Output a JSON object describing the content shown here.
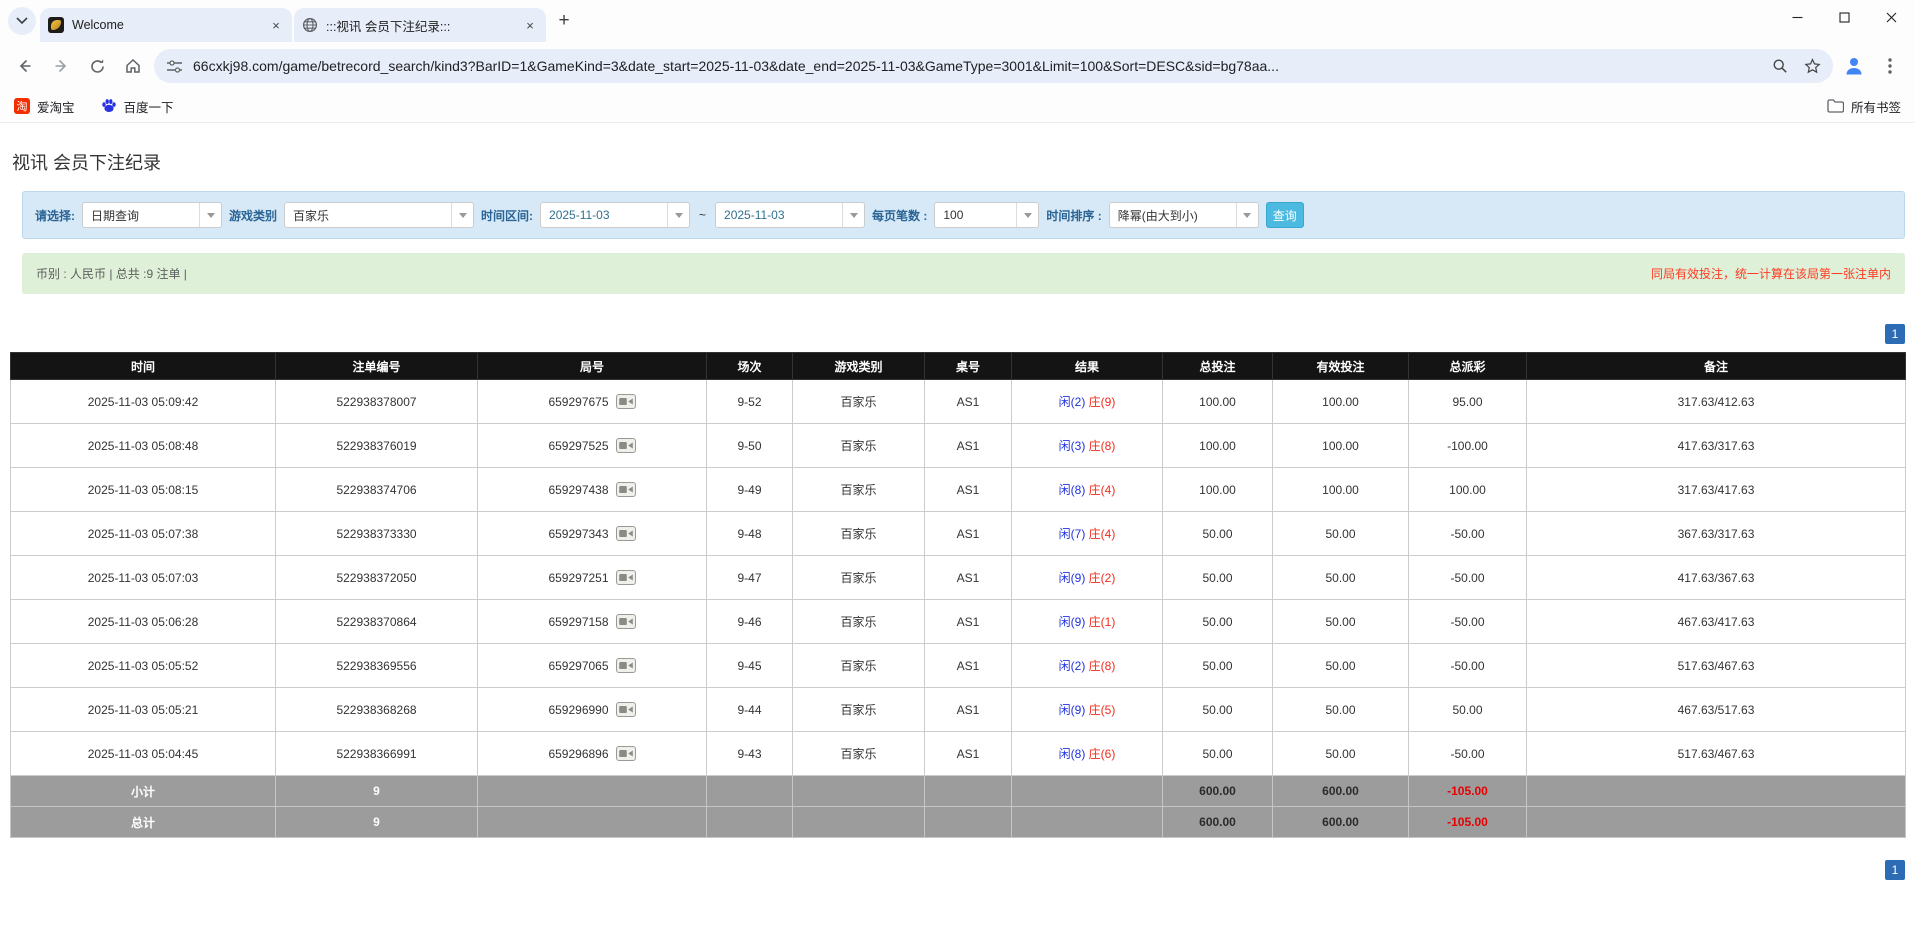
{
  "colors": {
    "filter_bg": "#d7e9f6",
    "info_bg": "#dff0d8",
    "header_bg": "#141414",
    "footer_bg": "#9c9c9c",
    "link_blue": "#0a64d2",
    "player_blue": "#1f32e0",
    "banker_red": "#f22b1d",
    "negative_red": "#f00000",
    "pagination_blue": "#2d6cb4",
    "button_blue": "#4cb9e0"
  },
  "browser": {
    "tabs": [
      {
        "title": "Welcome"
      },
      {
        "title": ":::视讯 会员下注纪录:::"
      }
    ],
    "close_glyph": "×",
    "newtab_glyph": "+",
    "url": "66cxkj98.com/game/betrecord_search/kind3?BarID=1&GameKind=3&date_start=2025-11-03&date_end=2025-11-03&GameType=3001&Limit=100&Sort=DESC&sid=bg78aa...",
    "bookmarks": [
      {
        "label": "爱淘宝",
        "icon_glyph": "淘"
      },
      {
        "label": "百度一下"
      }
    ],
    "bookmarks_right": "所有书签"
  },
  "page": {
    "title": "视讯 会员下注纪录",
    "filters": {
      "select_label": "请选择:",
      "select_value": "日期查询",
      "game_label": "游戏类别",
      "game_value": "百家乐",
      "range_label": "时间区间:",
      "date_start": "2025-11-03",
      "range_sep": "~",
      "date_end": "2025-11-03",
      "perpage_label": "每页笔数 :",
      "perpage_value": "100",
      "sort_label": "时间排序 :",
      "sort_value": "降幂(由大到小)",
      "search_button": "查询"
    },
    "infobar": {
      "left": "币别 : 人民币 | 总共 :9 注单 |",
      "right": "同局有效投注，统一计算在该局第一张注单内"
    },
    "pagination": "1",
    "table": {
      "headers": [
        "时间",
        "注单编号",
        "局号",
        "场次",
        "游戏类别",
        "桌号",
        "结果",
        "总投注",
        "有效投注",
        "总派彩",
        "备注"
      ],
      "rows": [
        {
          "time": "2025-11-03 05:09:42",
          "bet_id": "522938378007",
          "round_id": "659297675",
          "session": "9-52",
          "game_type": "百家乐",
          "table_no": "AS1",
          "result_player": "闲(2)",
          "result_banker": "庄(9)",
          "total_bet": "100.00",
          "valid_bet": "100.00",
          "payout": "95.00",
          "note": "317.63/412.63"
        },
        {
          "time": "2025-11-03 05:08:48",
          "bet_id": "522938376019",
          "round_id": "659297525",
          "session": "9-50",
          "game_type": "百家乐",
          "table_no": "AS1",
          "result_player": "闲(3)",
          "result_banker": "庄(8)",
          "total_bet": "100.00",
          "valid_bet": "100.00",
          "payout": "-100.00",
          "note": "417.63/317.63"
        },
        {
          "time": "2025-11-03 05:08:15",
          "bet_id": "522938374706",
          "round_id": "659297438",
          "session": "9-49",
          "game_type": "百家乐",
          "table_no": "AS1",
          "result_player": "闲(8)",
          "result_banker": "庄(4)",
          "total_bet": "100.00",
          "valid_bet": "100.00",
          "payout": "100.00",
          "note": "317.63/417.63"
        },
        {
          "time": "2025-11-03 05:07:38",
          "bet_id": "522938373330",
          "round_id": "659297343",
          "session": "9-48",
          "game_type": "百家乐",
          "table_no": "AS1",
          "result_player": "闲(7)",
          "result_banker": "庄(4)",
          "total_bet": "50.00",
          "valid_bet": "50.00",
          "payout": "-50.00",
          "note": "367.63/317.63"
        },
        {
          "time": "2025-11-03 05:07:03",
          "bet_id": "522938372050",
          "round_id": "659297251",
          "session": "9-47",
          "game_type": "百家乐",
          "table_no": "AS1",
          "result_player": "闲(9)",
          "result_banker": "庄(2)",
          "total_bet": "50.00",
          "valid_bet": "50.00",
          "payout": "-50.00",
          "note": "417.63/367.63"
        },
        {
          "time": "2025-11-03 05:06:28",
          "bet_id": "522938370864",
          "round_id": "659297158",
          "session": "9-46",
          "game_type": "百家乐",
          "table_no": "AS1",
          "result_player": "闲(9)",
          "result_banker": "庄(1)",
          "total_bet": "50.00",
          "valid_bet": "50.00",
          "payout": "-50.00",
          "note": "467.63/417.63"
        },
        {
          "time": "2025-11-03 05:05:52",
          "bet_id": "522938369556",
          "round_id": "659297065",
          "session": "9-45",
          "game_type": "百家乐",
          "table_no": "AS1",
          "result_player": "闲(2)",
          "result_banker": "庄(8)",
          "total_bet": "50.00",
          "valid_bet": "50.00",
          "payout": "-50.00",
          "note": "517.63/467.63"
        },
        {
          "time": "2025-11-03 05:05:21",
          "bet_id": "522938368268",
          "round_id": "659296990",
          "session": "9-44",
          "game_type": "百家乐",
          "table_no": "AS1",
          "result_player": "闲(9)",
          "result_banker": "庄(5)",
          "total_bet": "50.00",
          "valid_bet": "50.00",
          "payout": "50.00",
          "note": "467.63/517.63"
        },
        {
          "time": "2025-11-03 05:04:45",
          "bet_id": "522938366991",
          "round_id": "659296896",
          "session": "9-43",
          "game_type": "百家乐",
          "table_no": "AS1",
          "result_player": "闲(8)",
          "result_banker": "庄(6)",
          "total_bet": "50.00",
          "valid_bet": "50.00",
          "payout": "-50.00",
          "note": "517.63/467.63"
        }
      ],
      "subtotal": {
        "label": "小计",
        "count": "9",
        "total_bet": "600.00",
        "valid_bet": "600.00",
        "payout": "-105.00"
      },
      "total": {
        "label": "总计",
        "count": "9",
        "total_bet": "600.00",
        "valid_bet": "600.00",
        "payout": "-105.00"
      }
    }
  }
}
